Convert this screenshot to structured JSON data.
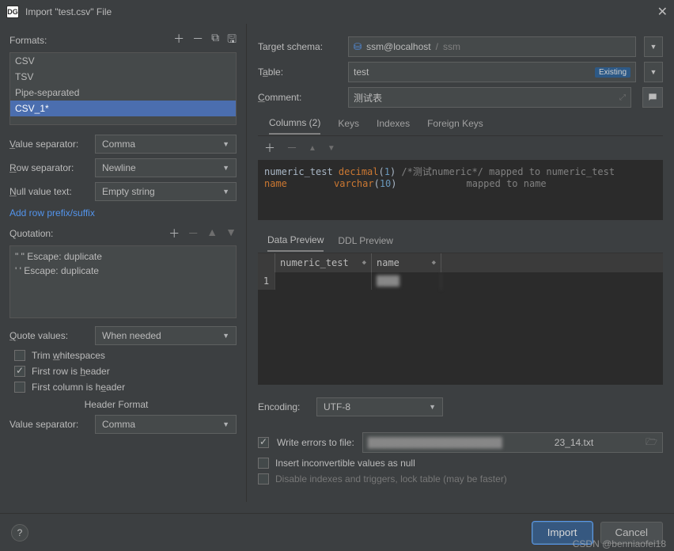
{
  "title": "Import \"test.csv\" File",
  "left": {
    "formats_label": "Formats:",
    "formats": [
      "CSV",
      "TSV",
      "Pipe-separated",
      "CSV_1*"
    ],
    "value_sep_label": "Value separator:",
    "value_sep": "Comma",
    "row_sep_label": "Row separator:",
    "row_sep": "Newline",
    "null_label": "Null value text:",
    "null_val": "Empty string",
    "add_prefix": "Add row prefix/suffix",
    "quotation_label": "Quotation:",
    "quote_lines": [
      "\"  \"  Escape: duplicate",
      "'  '  Escape: duplicate"
    ],
    "quote_values_label": "Quote values:",
    "quote_values": "When needed",
    "trim_ws": "Trim whitespaces",
    "first_row_header": "First row is header",
    "first_col_header": "First column is header",
    "header_format": "Header Format",
    "value_sep2_label": "Value separator:",
    "value_sep2": "Comma"
  },
  "right": {
    "target_schema_label": "Target schema:",
    "schema_user": "ssm@localhost",
    "schema_sep": " / ",
    "schema_db": "ssm",
    "table_label": "Table:",
    "table_name": "test",
    "existing_badge": "Existing",
    "comment_label": "Comment:",
    "comment_value": "测试表",
    "tabs": {
      "columns": "Columns (2)",
      "keys": "Keys",
      "indexes": "Indexes",
      "fkeys": "Foreign Keys"
    },
    "code": {
      "l1a": "numeric_test ",
      "l1b": "decimal",
      "l1c": "(",
      "l1d": "1",
      "l1e": ")",
      "l1f": " /*测试numeric*/",
      "l1g": " mapped to numeric_test",
      "l2a": "name",
      "l2b": "varchar",
      "l2c": "(",
      "l2d": "10",
      "l2e": ")",
      "l2g": "mapped to name"
    },
    "subtabs": {
      "data": "Data Preview",
      "ddl": "DDL Preview"
    },
    "preview_cols": [
      "numeric_test",
      "name"
    ],
    "preview_rownum": "1",
    "encoding_label": "Encoding:",
    "encoding": "UTF-8",
    "write_errors": "Write errors to file:",
    "file_suffix": "23_14.txt",
    "insert_null": "Insert inconvertible values as null",
    "disable_idx": "Disable indexes and triggers, lock table (may be faster)"
  },
  "footer": {
    "import": "Import",
    "cancel": "Cancel"
  },
  "watermark": "CSDN @benniaofei18"
}
